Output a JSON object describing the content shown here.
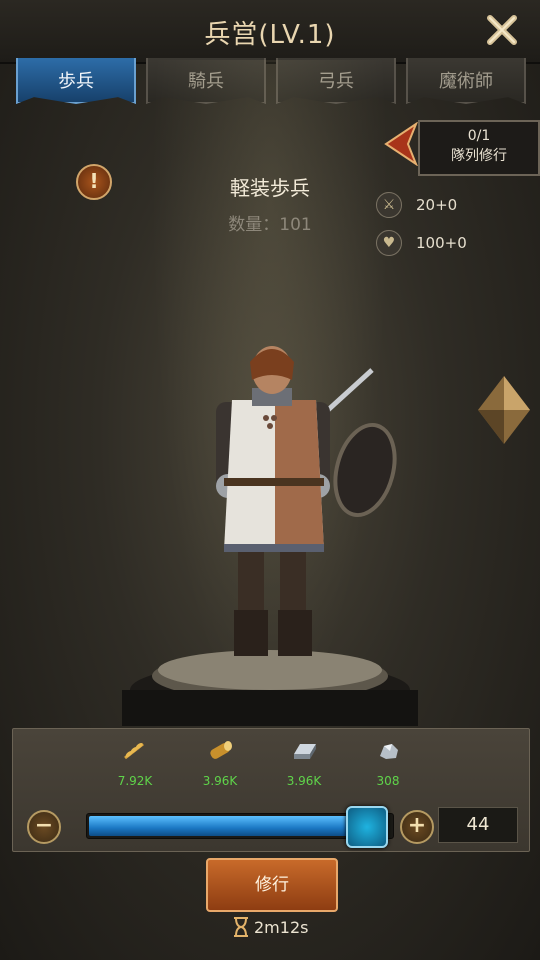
{
  "header": {
    "title": "兵営(LV.1)"
  },
  "tabs": [
    {
      "label": "歩兵",
      "active": true
    },
    {
      "label": "騎兵",
      "active": false
    },
    {
      "label": "弓兵",
      "active": false
    },
    {
      "label": "魔術師",
      "active": false
    }
  ],
  "queue": {
    "count": "0/1",
    "label": "隊列修行"
  },
  "unit": {
    "name": "軽装歩兵",
    "count_label": "数量：101"
  },
  "stats": {
    "attack": "20+0",
    "health": "100+0"
  },
  "resources": [
    {
      "icon": "wheat-icon",
      "value": "7.92K"
    },
    {
      "icon": "wood-log-icon",
      "value": "3.96K"
    },
    {
      "icon": "iron-ingot-icon",
      "value": "3.96K"
    },
    {
      "icon": "silver-ore-icon",
      "value": "308"
    }
  ],
  "slider": {
    "fraction": 0.93
  },
  "quantity": "44",
  "train_button": "修行",
  "timer": "2m12s",
  "colors": {
    "accent_blue": "#2d6da8",
    "train_orange": "#c86a2a",
    "resource_green": "#5fd44a"
  }
}
